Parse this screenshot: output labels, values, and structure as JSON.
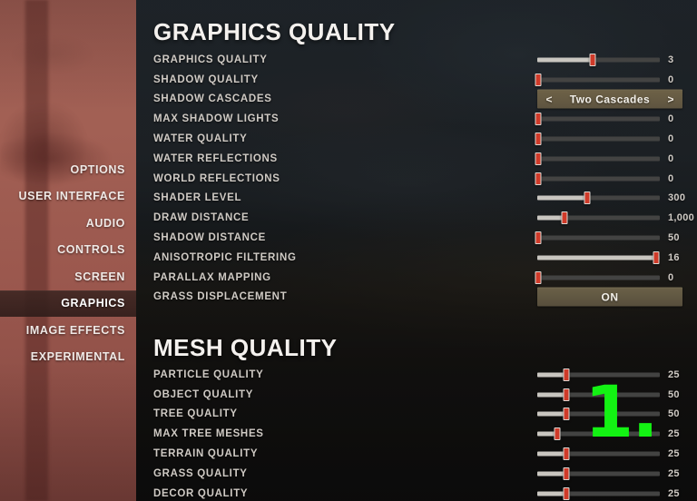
{
  "sidebar": {
    "items": [
      {
        "label": "OPTIONS",
        "active": false
      },
      {
        "label": "USER INTERFACE",
        "active": false
      },
      {
        "label": "AUDIO",
        "active": false
      },
      {
        "label": "CONTROLS",
        "active": false
      },
      {
        "label": "SCREEN",
        "active": false
      },
      {
        "label": "GRAPHICS",
        "active": true
      },
      {
        "label": "IMAGE EFFECTS",
        "active": false
      },
      {
        "label": "EXPERIMENTAL",
        "active": false
      }
    ],
    "background_color": "#9d5d53",
    "active_highlight_color": "#3a2420"
  },
  "sections": [
    {
      "title": "GRAPHICS QUALITY",
      "rows": [
        {
          "label": "GRAPHICS QUALITY",
          "type": "slider",
          "value": "3",
          "percent": 45
        },
        {
          "label": "SHADOW QUALITY",
          "type": "slider",
          "value": "0",
          "percent": 1
        },
        {
          "label": "SHADOW CASCADES",
          "type": "spinner",
          "value": "Two Cascades",
          "left_arrow": "<",
          "right_arrow": ">"
        },
        {
          "label": "MAX SHADOW LIGHTS",
          "type": "slider",
          "value": "0",
          "percent": 1
        },
        {
          "label": "WATER QUALITY",
          "type": "slider",
          "value": "0",
          "percent": 1
        },
        {
          "label": "WATER REFLECTIONS",
          "type": "slider",
          "value": "0",
          "percent": 1
        },
        {
          "label": "WORLD REFLECTIONS",
          "type": "slider",
          "value": "0",
          "percent": 1
        },
        {
          "label": "SHADER LEVEL",
          "type": "slider",
          "value": "300",
          "percent": 41
        },
        {
          "label": "DRAW DISTANCE",
          "type": "slider",
          "value": "1,000",
          "percent": 22
        },
        {
          "label": "SHADOW DISTANCE",
          "type": "slider",
          "value": "50",
          "percent": 1
        },
        {
          "label": "ANISOTROPIC FILTERING",
          "type": "slider",
          "value": "16",
          "percent": 97
        },
        {
          "label": "PARALLAX MAPPING",
          "type": "slider",
          "value": "0",
          "percent": 1
        },
        {
          "label": "GRASS DISPLACEMENT",
          "type": "toggle",
          "value": "ON"
        }
      ]
    },
    {
      "title": "MESH QUALITY",
      "rows": [
        {
          "label": "PARTICLE QUALITY",
          "type": "slider",
          "value": "25",
          "percent": 24
        },
        {
          "label": "OBJECT QUALITY",
          "type": "slider",
          "value": "50",
          "percent": 24
        },
        {
          "label": "TREE QUALITY",
          "type": "slider",
          "value": "50",
          "percent": 24
        },
        {
          "label": "MAX TREE MESHES",
          "type": "slider",
          "value": "25",
          "percent": 16
        },
        {
          "label": "TERRAIN QUALITY",
          "type": "slider",
          "value": "25",
          "percent": 24
        },
        {
          "label": "GRASS QUALITY",
          "type": "slider",
          "value": "25",
          "percent": 24
        },
        {
          "label": "DECOR QUALITY",
          "type": "slider",
          "value": "25",
          "percent": 24
        }
      ]
    }
  ],
  "annotation": {
    "label": "1.",
    "color": "#13f213"
  }
}
